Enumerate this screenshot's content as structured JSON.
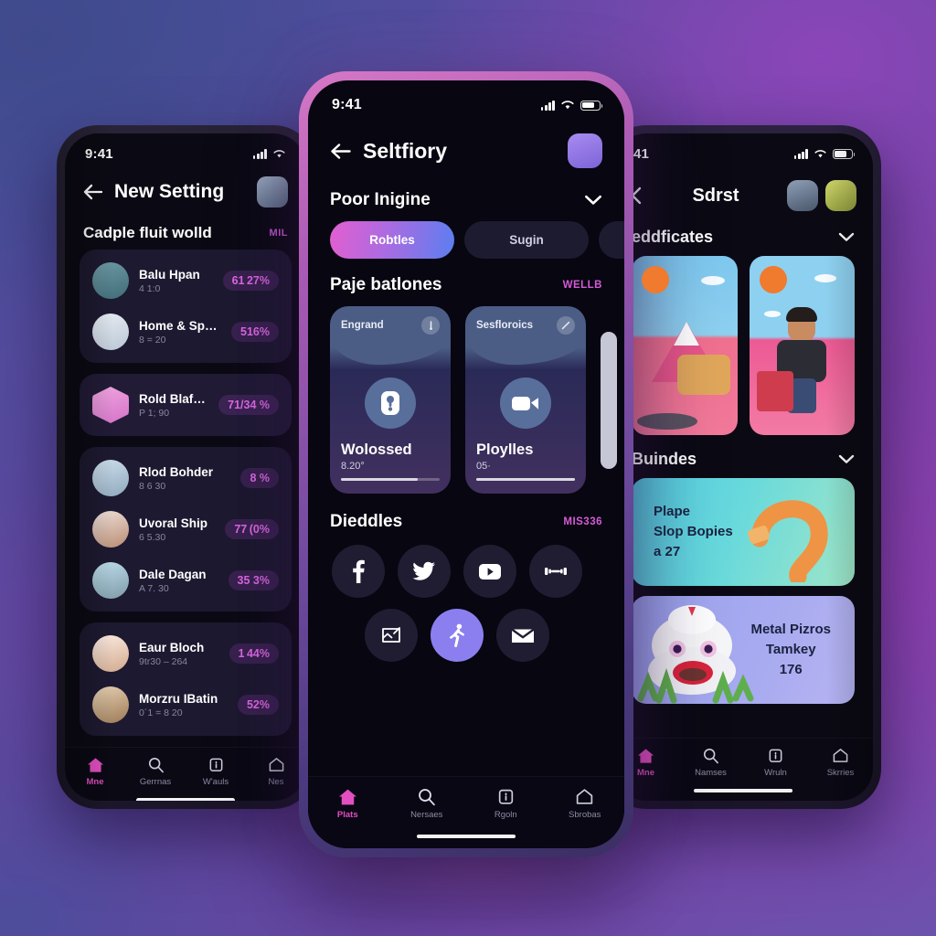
{
  "background": {
    "from": "#45509a",
    "mid": "#7c3fa6",
    "to": "#6a53ad"
  },
  "accents": {
    "magenta": "#e24fc0",
    "purple": "#8b7ff0",
    "pill": "#e06ae8"
  },
  "phones": {
    "left": {
      "status": {
        "time": "9:41"
      },
      "appbar": {
        "back_icon": "arrow-left-icon",
        "title": "New Setting",
        "avatar": "avatar"
      },
      "section": {
        "title": "Cadple fluit wolld",
        "more": "MIL"
      },
      "groups": [
        {
          "rows": [
            {
              "name": "Balu Hpan",
              "sub": "4 1:0",
              "pct": "61 27%"
            },
            {
              "name": "Home & Sppest",
              "sub": "8 = 20",
              "pct": "516%"
            }
          ]
        },
        {
          "rows": [
            {
              "name": "Rold Blafton",
              "sub": "P 1; 90",
              "pct": "71/34 %"
            }
          ]
        },
        {
          "rows": [
            {
              "name": "Rlod Bohder",
              "sub": "8 6 30",
              "pct": "8 %"
            },
            {
              "name": "Uvoral Ship",
              "sub": "6 5.30",
              "pct": "77 (0%"
            },
            {
              "name": "Dale Dagan",
              "sub": "A 7. 30",
              "pct": "35 3%"
            }
          ]
        },
        {
          "rows": [
            {
              "name": "Eaur Bloch",
              "sub": "9tr30 – 264",
              "pct": "1 44%"
            },
            {
              "name": "Morzru IBatin",
              "sub": "0´1 = 8 20",
              "pct": "52%"
            }
          ]
        }
      ],
      "tabs": [
        {
          "icon": "home-icon",
          "label": "Mne",
          "active": true
        },
        {
          "icon": "search-icon",
          "label": "Gerrnas",
          "active": false
        },
        {
          "icon": "info-box-icon",
          "label": "W'auls",
          "active": false
        },
        {
          "icon": "pentagon-icon",
          "label": "Nes",
          "active": false
        }
      ]
    },
    "center": {
      "status": {
        "time": "9:41"
      },
      "appbar": {
        "back_icon": "arrow-left-icon",
        "title": "Seltfiory",
        "avatar": "avatar"
      },
      "filter": {
        "title": "Poor Inigine",
        "chevron_icon": "chevron-down-icon"
      },
      "segments": [
        {
          "label": "Robtles",
          "active": true
        },
        {
          "label": "Sugin",
          "active": false
        },
        {
          "label": "",
          "active": false
        }
      ],
      "cards_section": {
        "title": "Paje batlones",
        "more": "WELLB"
      },
      "cards": [
        {
          "header": "Engrand",
          "badge_icon": "pin-icon",
          "icon": "key-icon",
          "title": "Wolossed",
          "meta": "8.20°",
          "progress": 78
        },
        {
          "header": "Sesfloroics",
          "badge_icon": "pencil-icon",
          "icon": "video-camera-icon",
          "title": "Ploylles",
          "meta": "05·",
          "progress": 100
        }
      ],
      "socials_section": {
        "title": "Dieddles",
        "more": "MIS336"
      },
      "socials_row1": [
        {
          "icon": "facebook-icon",
          "highlight": false
        },
        {
          "icon": "twitter-icon",
          "highlight": false
        },
        {
          "icon": "youtube-icon",
          "highlight": false
        },
        {
          "icon": "dumbbell-icon",
          "highlight": false
        }
      ],
      "socials_row2": [
        {
          "icon": "broken-image-icon",
          "highlight": false
        },
        {
          "icon": "runner-icon",
          "highlight": true
        },
        {
          "icon": "mail-icon",
          "highlight": false
        }
      ],
      "tabs": [
        {
          "icon": "home-icon",
          "label": "Plats",
          "active": true
        },
        {
          "icon": "search-icon",
          "label": "Nersaes",
          "active": false
        },
        {
          "icon": "info-box-icon",
          "label": "Rgoln",
          "active": false
        },
        {
          "icon": "pentagon-icon",
          "label": "Sbrobas",
          "active": false
        }
      ]
    },
    "right": {
      "status": {
        "time": "41"
      },
      "appbar": {
        "back_icon": "chevron-left-icon",
        "title": "Sdrst",
        "avatars": [
          "avatar-1",
          "avatar-2"
        ]
      },
      "section_avatars": {
        "title": "eddficates",
        "chevron_icon": "chevron-down-icon"
      },
      "avatar_cards": [
        {
          "name": "mountain-scene-card"
        },
        {
          "name": "character-scene-card"
        }
      ],
      "section_bundles": {
        "title": "Buindes",
        "chevron_icon": "chevron-down-icon"
      },
      "banners": [
        {
          "line1": "Plape",
          "line2": "Slop Bopies",
          "line3": "a 27",
          "art": "orange-tube-icon"
        },
        {
          "line1": "Metal Pizros",
          "line2": "Tamkey",
          "line3": "176",
          "art": "white-creature-icon"
        }
      ],
      "tabs": [
        {
          "icon": "home-icon",
          "label": "Mne",
          "active": true
        },
        {
          "icon": "search-icon",
          "label": "Namses",
          "active": false
        },
        {
          "icon": "info-box-icon",
          "label": "Wruln",
          "active": false
        },
        {
          "icon": "pentagon-icon",
          "label": "Skrries",
          "active": false
        }
      ]
    }
  }
}
